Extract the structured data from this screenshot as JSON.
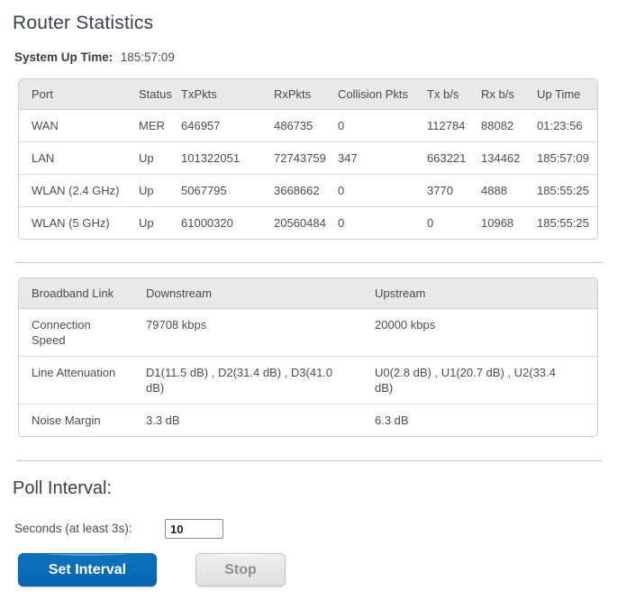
{
  "page": {
    "title": "Router Statistics",
    "system_up_time_label": "System Up Time:",
    "system_up_time_value": "185:57:09"
  },
  "port_table": {
    "headers": [
      "Port",
      "Status",
      "TxPkts",
      "RxPkts",
      "Collision Pkts",
      "Tx b/s",
      "Rx b/s",
      "Up Time"
    ],
    "rows": [
      {
        "port": "WAN",
        "status": "MER",
        "tx_pkts": "646957",
        "rx_pkts": "486735",
        "collision_pkts": "0",
        "tx_bs": "112784",
        "rx_bs": "88082",
        "up_time": "01:23:56"
      },
      {
        "port": "LAN",
        "status": "Up",
        "tx_pkts": "101322051",
        "rx_pkts": "72743759",
        "collision_pkts": "347",
        "tx_bs": "663221",
        "rx_bs": "134462",
        "up_time": "185:57:09"
      },
      {
        "port": "WLAN (2.4 GHz)",
        "status": "Up",
        "tx_pkts": "5067795",
        "rx_pkts": "3668662",
        "collision_pkts": "0",
        "tx_bs": "3770",
        "rx_bs": "4888",
        "up_time": "185:55:25"
      },
      {
        "port": "WLAN (5 GHz)",
        "status": "Up",
        "tx_pkts": "61000320",
        "rx_pkts": "20560484",
        "collision_pkts": "0",
        "tx_bs": "0",
        "rx_bs": "10968",
        "up_time": "185:55:25"
      }
    ]
  },
  "broadband_table": {
    "headers": [
      "Broadband Link",
      "Downstream",
      "Upstream"
    ],
    "rows": [
      {
        "label": "Connection Speed",
        "downstream": "79708 kbps",
        "upstream": "20000 kbps"
      },
      {
        "label": "Line Attenuation",
        "downstream": "D1(11.5 dB) , D2(31.4 dB) , D3(41.0 dB)",
        "upstream": "U0(2.8 dB) , U1(20.7 dB) , U2(33.4 dB)"
      },
      {
        "label": "Noise Margin",
        "downstream": "3.3 dB",
        "upstream": "6.3 dB"
      }
    ]
  },
  "poll": {
    "heading": "Poll Interval:",
    "seconds_label": "Seconds (at least 3s):",
    "seconds_value": "10",
    "set_button_label": "Set Interval",
    "stop_button_label": "Stop"
  },
  "colors": {
    "accent_blue": "#0c71bd",
    "table_header_bg": "#e9e9e9",
    "border_gray": "#cccccc",
    "text_gray": "#4d4d4d",
    "title_navy": "#39404c"
  }
}
